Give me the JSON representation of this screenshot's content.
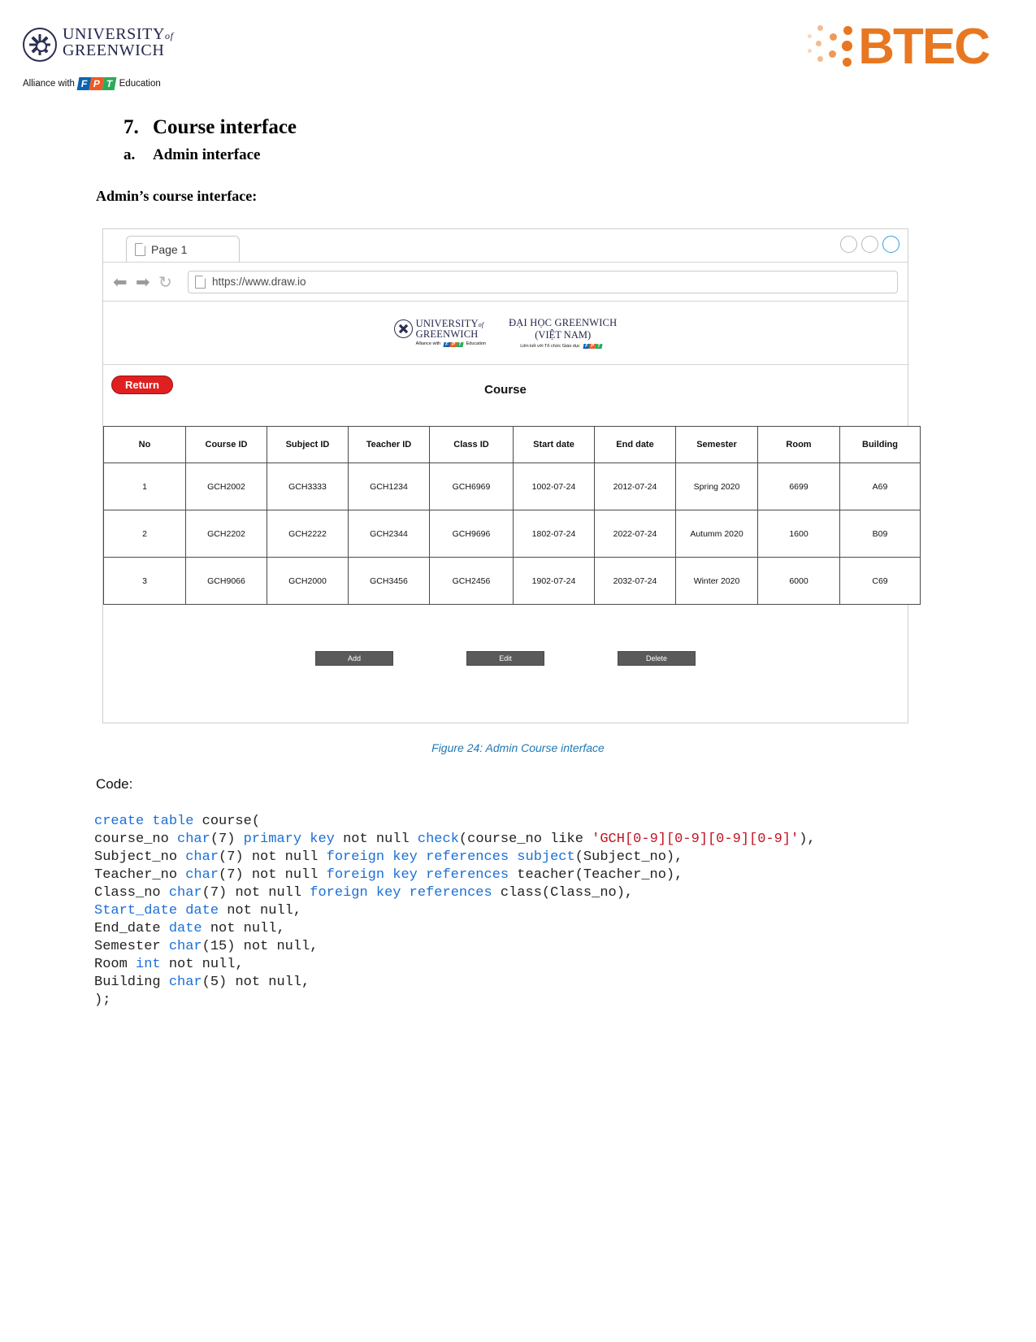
{
  "header": {
    "university_line1": "UNIVERSITY",
    "university_of": "of",
    "university_line2": "GREENWICH",
    "alliance_prefix": "Alliance with",
    "alliance_suffix": "Education",
    "fpt_f": "F",
    "fpt_p": "P",
    "fpt_t": "T",
    "btec": "BTEC",
    "brand_orange": "#e87722",
    "brand_navy": "#23264a"
  },
  "headings": {
    "section_number": "7.",
    "section_title": "Course interface",
    "sub_number": "a.",
    "sub_title": "Admin interface",
    "lead": "Admin’s course interface:"
  },
  "browser": {
    "tab_label": "Page 1",
    "url": "https://www.draw.io",
    "back_icon": "back-arrow-icon",
    "forward_icon": "forward-arrow-icon",
    "reload_icon": "reload-icon",
    "page_icon": "page-icon"
  },
  "app": {
    "banner": {
      "left_line1": "UNIVERSITY",
      "left_of": "of",
      "left_line2": "GREENWICH",
      "left_sub_prefix": "Alliance with",
      "left_sub_suffix": "Education",
      "right_line1": "ĐẠI HỌC GREENWICH",
      "right_line2": "(VIỆT NAM)",
      "right_sub": "Liên kết với Tổ chức Giáo dục"
    },
    "return_label": "Return",
    "page_title": "Course",
    "table": {
      "columns": [
        "No",
        "Course ID",
        "Subject ID",
        "Teacher ID",
        "Class ID",
        "Start date",
        "End date",
        "Semester",
        "Room",
        "Building"
      ],
      "rows": [
        [
          "1",
          "GCH2002",
          "GCH3333",
          "GCH1234",
          "GCH6969",
          "1002-07-24",
          "2012-07-24",
          "Spring 2020",
          "6699",
          "A69"
        ],
        [
          "2",
          "GCH2202",
          "GCH2222",
          "GCH2344",
          "GCH9696",
          "1802-07-24",
          "2022-07-24",
          "Autumm 2020",
          "1600",
          "B09"
        ],
        [
          "3",
          "GCH9066",
          "GCH2000",
          "GCH3456",
          "GCH2456",
          "1902-07-24",
          "2032-07-24",
          "Winter 2020",
          "6000",
          "C69"
        ]
      ]
    },
    "buttons": [
      {
        "name": "add-button",
        "label": "Add"
      },
      {
        "name": "edit-button",
        "label": "Edit"
      },
      {
        "name": "delete-button",
        "label": "Delete"
      }
    ]
  },
  "caption": "Figure 24: Admin Course interface",
  "code_label": "Code:",
  "code_lines": [
    [
      {
        "t": "create table ",
        "c": "kw"
      },
      {
        "t": "course(",
        "c": ""
      }
    ],
    [
      {
        "t": "course_no ",
        "c": ""
      },
      {
        "t": "char",
        "c": "kw"
      },
      {
        "t": "(7) ",
        "c": ""
      },
      {
        "t": "primary key",
        "c": "kw"
      },
      {
        "t": " not null ",
        "c": ""
      },
      {
        "t": "check",
        "c": "kw"
      },
      {
        "t": "(course_no like ",
        "c": ""
      },
      {
        "t": "'GCH[0-9][0-9][0-9][0-9]'",
        "c": "str"
      },
      {
        "t": "),",
        "c": ""
      }
    ],
    [
      {
        "t": "Subject_no ",
        "c": ""
      },
      {
        "t": "char",
        "c": "kw"
      },
      {
        "t": "(7) not null ",
        "c": ""
      },
      {
        "t": "foreign key references subject",
        "c": "kw"
      },
      {
        "t": "(Subject_no),",
        "c": ""
      }
    ],
    [
      {
        "t": "Teacher_no ",
        "c": ""
      },
      {
        "t": "char",
        "c": "kw"
      },
      {
        "t": "(7) not null ",
        "c": ""
      },
      {
        "t": "foreign key references",
        "c": "kw"
      },
      {
        "t": " teacher(Teacher_no),",
        "c": ""
      }
    ],
    [
      {
        "t": "Class_no ",
        "c": ""
      },
      {
        "t": "char",
        "c": "kw"
      },
      {
        "t": "(7) not null ",
        "c": ""
      },
      {
        "t": "foreign key references",
        "c": "kw"
      },
      {
        "t": " class(Class_no),",
        "c": ""
      }
    ],
    [
      {
        "t": "Start_date date",
        "c": "kw"
      },
      {
        "t": " not null,",
        "c": ""
      }
    ],
    [
      {
        "t": "End_date ",
        "c": ""
      },
      {
        "t": "date",
        "c": "kw"
      },
      {
        "t": " not null,",
        "c": ""
      }
    ],
    [
      {
        "t": "Semester ",
        "c": ""
      },
      {
        "t": "char",
        "c": "kw"
      },
      {
        "t": "(15) not null,",
        "c": ""
      }
    ],
    [
      {
        "t": "Room ",
        "c": ""
      },
      {
        "t": "int",
        "c": "kw"
      },
      {
        "t": " not null,",
        "c": ""
      }
    ],
    [
      {
        "t": "Building ",
        "c": ""
      },
      {
        "t": "char",
        "c": "kw"
      },
      {
        "t": "(5) not null,",
        "c": ""
      }
    ],
    [
      {
        "t": ");",
        "c": ""
      }
    ]
  ]
}
